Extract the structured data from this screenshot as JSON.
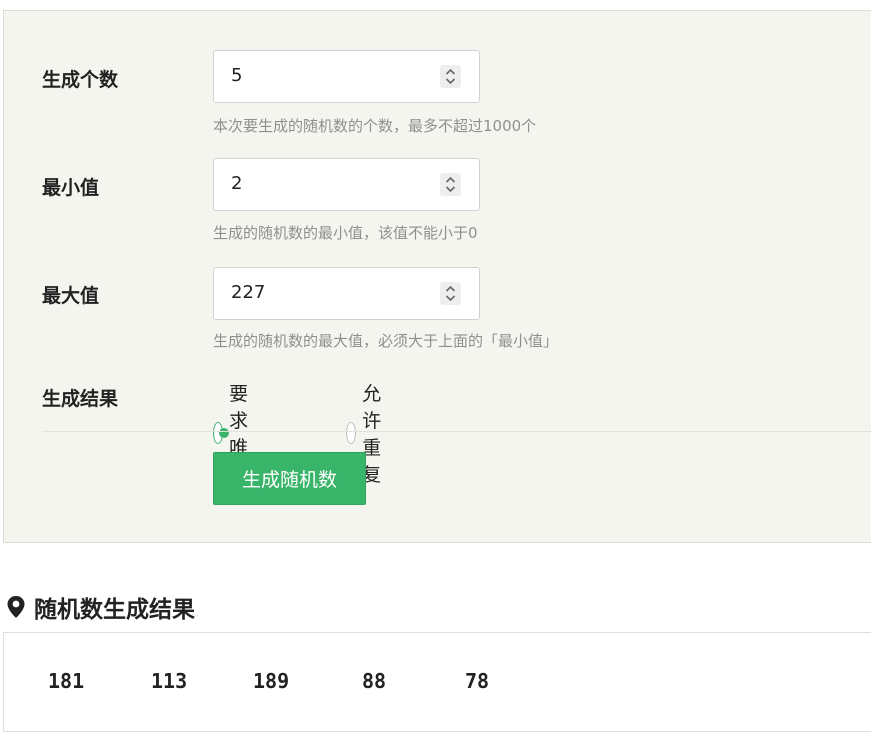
{
  "form": {
    "count": {
      "label": "生成个数",
      "value": "5",
      "hint": "本次要生成的随机数的个数，最多不超过1000个"
    },
    "min": {
      "label": "最小值",
      "value": "2",
      "hint": "生成的随机数的最小值，该值不能小于0"
    },
    "max": {
      "label": "最大值",
      "value": "227",
      "hint": "生成的随机数的最大值，必须大于上面的「最小值」"
    },
    "result_mode": {
      "label": "生成结果",
      "options": [
        {
          "label": "要求唯一",
          "checked": true
        },
        {
          "label": "允许重复",
          "checked": false
        }
      ]
    },
    "submit_label": "生成随机数"
  },
  "results": {
    "title": "随机数生成结果",
    "icon": "map-pin-icon",
    "numbers": [
      "181",
      "113",
      "189",
      "88",
      "78"
    ]
  },
  "colors": {
    "accent": "#39b56a",
    "panel_bg": "#f5f5f0",
    "hint": "#8f8f8f"
  }
}
